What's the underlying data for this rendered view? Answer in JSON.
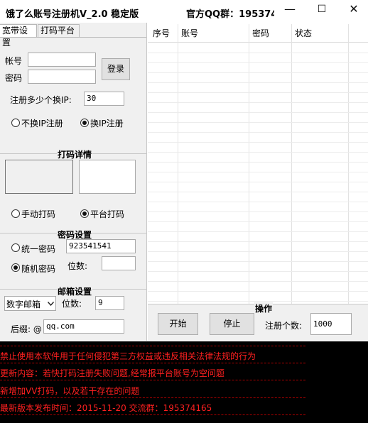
{
  "window": {
    "title": "饿了么账号注册机V_2.0 稳定版",
    "qq_group": "官方QQ群：195374...",
    "minimize": "—",
    "maximize": "☐",
    "close": "✕"
  },
  "tabs": [
    "宽带设置",
    "打码平台"
  ],
  "login": {
    "account_label": "帐号",
    "password_label": "密码",
    "account_value": "",
    "password_value": "",
    "login_button": "登录"
  },
  "ip": {
    "label": "注册多少个换IP:",
    "value": "30",
    "no_change_label": "不换IP注册",
    "change_label": "换IP注册",
    "selected": "change"
  },
  "captcha": {
    "heading": "打码详情",
    "manual_label": "手动打码",
    "platform_label": "平台打码",
    "selected": "platform"
  },
  "password_settings": {
    "heading": "密码设置",
    "unified_label": "统一密码",
    "unified_value": "923541541",
    "random_label": "随机密码",
    "digits_label": "位数:",
    "digits_value": "",
    "selected": "random"
  },
  "email_settings": {
    "heading": "邮箱设置",
    "type_value": "数字邮箱",
    "digits_label": "位数:",
    "digits_value": "9",
    "suffix_label": "后缀: @",
    "suffix_value": "qq.com"
  },
  "table": {
    "columns": [
      "序号",
      "账号",
      "密码",
      "状态"
    ],
    "rows": []
  },
  "operations": {
    "heading": "操作",
    "start_button": "开始",
    "stop_button": "停止",
    "count_label": "注册个数:",
    "count_value": "1000"
  },
  "log": [
    "禁止使用本软件用于任何侵犯第三方权益或违反相关法律法规的行为",
    "更新内容：若快打码注册失败问题,经常报平台账号为空问题",
    "新增加VV打码，以及若干存在的问题",
    "最新版本发布时间：2015-11-20 交流群：195374165"
  ],
  "colors": {
    "log_text": "#ff2020",
    "log_background": "#000000"
  }
}
